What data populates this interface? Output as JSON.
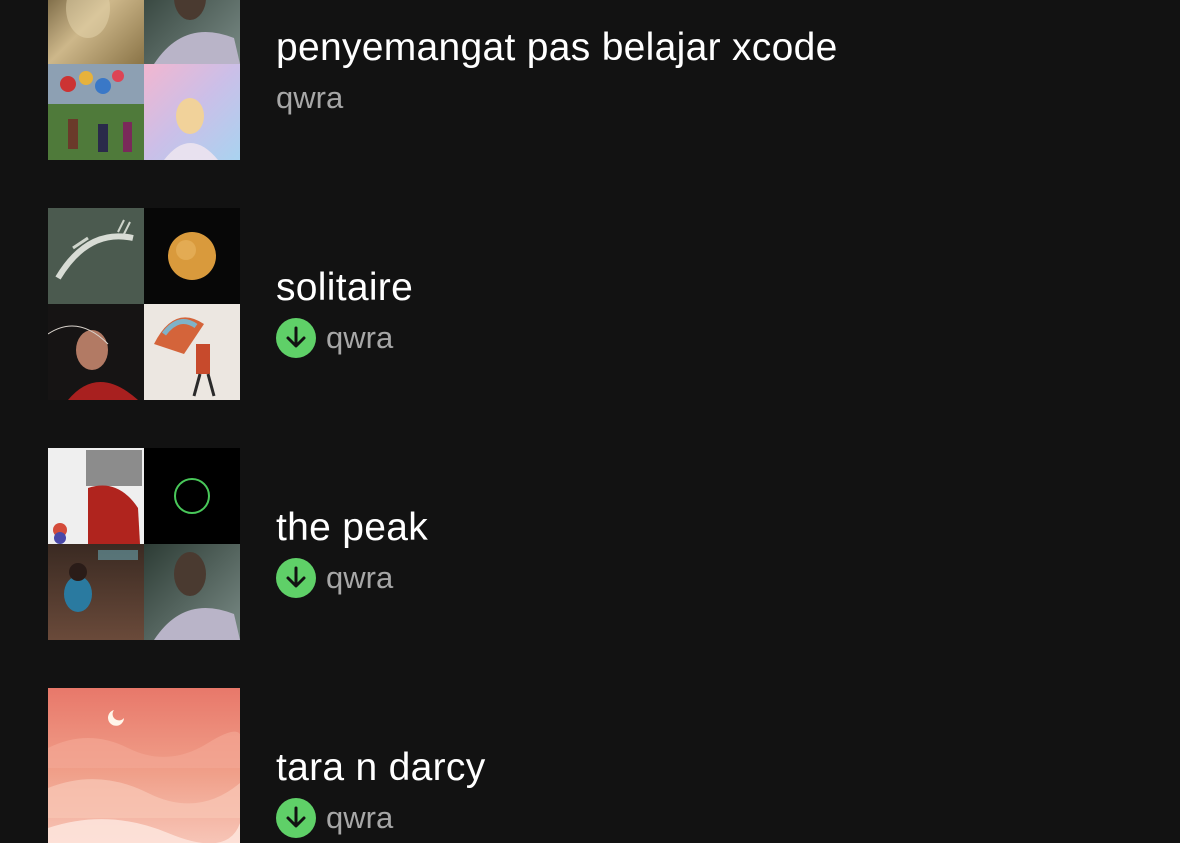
{
  "playlists": [
    {
      "title": "penyemangat pas belajar xcode",
      "owner": "qwra",
      "downloaded": false
    },
    {
      "title": "solitaire",
      "owner": "qwra",
      "downloaded": true
    },
    {
      "title": "the peak",
      "owner": "qwra",
      "downloaded": true
    },
    {
      "title": "tara n darcy",
      "owner": "qwra",
      "downloaded": true
    }
  ],
  "icons": {
    "download": "download-arrow-icon"
  },
  "colors": {
    "background": "#121212",
    "title": "#ffffff",
    "subtitle": "#a7a7a7",
    "download_badge": "#5fd068"
  }
}
